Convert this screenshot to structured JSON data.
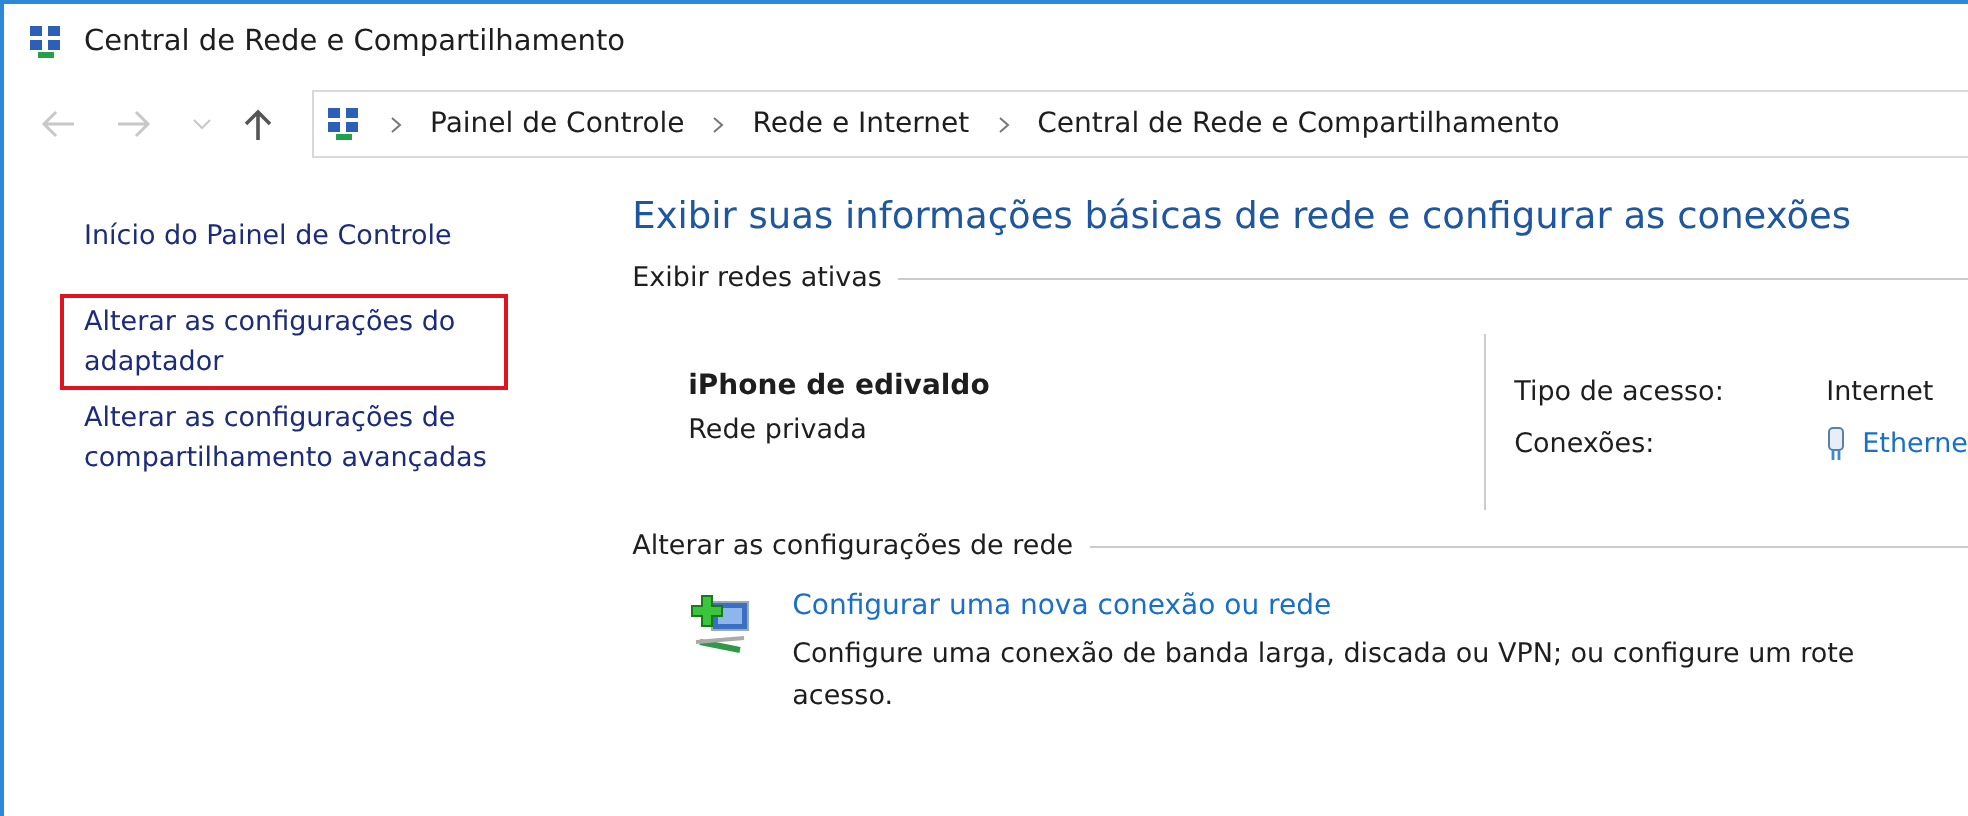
{
  "window": {
    "title": "Central de Rede e Compartilhamento"
  },
  "navigation": {
    "breadcrumbs": [
      "Painel de Controle",
      "Rede e Internet",
      "Central de Rede e Compartilhamento"
    ]
  },
  "sidebar": {
    "items": [
      {
        "label": "Início do Painel de Controle",
        "highlighted": false
      },
      {
        "label": "Alterar as configurações do adaptador",
        "highlighted": true
      },
      {
        "label": "Alterar as configurações de compartilhamento avançadas",
        "highlighted": false
      }
    ]
  },
  "main": {
    "heading": "Exibir suas informações básicas de rede e configurar as conexões",
    "active_networks": {
      "title": "Exibir redes ativas",
      "network_name": "iPhone de edivaldo",
      "network_type": "Rede privada",
      "properties": [
        {
          "label": "Tipo de acesso:",
          "value": "Internet",
          "kind": "text"
        },
        {
          "label": "Conexões:",
          "value": "Etherne",
          "kind": "link"
        }
      ]
    },
    "change_settings": {
      "title": "Alterar as configurações de rede",
      "tasks": [
        {
          "link": "Configurar uma nova conexão ou rede",
          "description": [
            "Configure uma conexão de banda larga, discada ou VPN; ou configure um rote",
            "acesso."
          ]
        }
      ]
    }
  }
}
